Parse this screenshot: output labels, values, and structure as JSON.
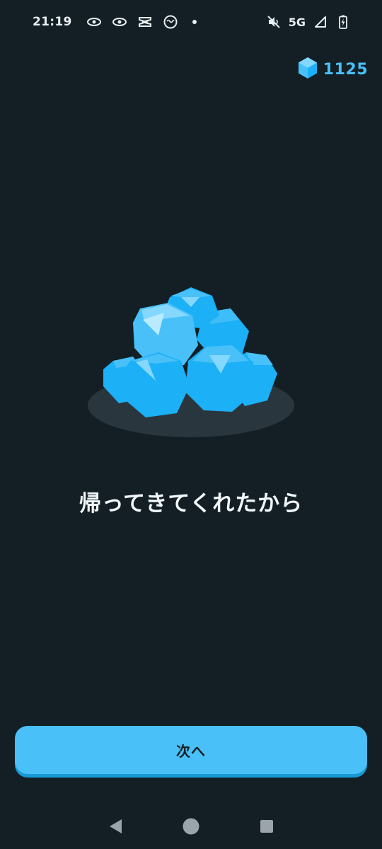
{
  "status_bar": {
    "time": "21:19",
    "network": "5G",
    "icons": [
      "eye-icon",
      "eye-icon",
      "capcut-icon",
      "face-icon",
      "notification-dot",
      "mute-icon",
      "signal-icon",
      "battery-charging-icon"
    ]
  },
  "gems": {
    "count": "1125",
    "icon": "gem-icon",
    "color": "#49c0f8"
  },
  "illustration": {
    "icon": "gem-pile-icon"
  },
  "message": {
    "title": "帰ってきてくれたから"
  },
  "next_button": {
    "label": "次へ",
    "color": "#49c0f8"
  },
  "nav_bar": {
    "icons": [
      "back-icon",
      "home-icon",
      "recents-icon"
    ]
  }
}
